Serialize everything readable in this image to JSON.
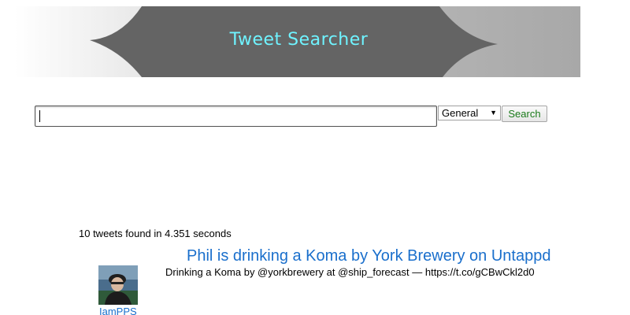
{
  "header": {
    "title": "Tweet Searcher"
  },
  "search": {
    "value": "",
    "placeholder": "",
    "scope_selected": "General",
    "button_label": "Search"
  },
  "results": {
    "summary": "10 tweets found in 4.351 seconds",
    "tweets": [
      {
        "title": "Phil is drinking a Koma by York Brewery on Untappd",
        "body": "Drinking a Koma by @yorkbrewery at @ship_forecast — https://t.co/gCBwCkl2d0",
        "username": "IamPPS"
      }
    ]
  },
  "colors": {
    "banner_title": "#6ff3ff",
    "link": "#1a6fcc",
    "search_button_text": "#1a7a1a"
  }
}
